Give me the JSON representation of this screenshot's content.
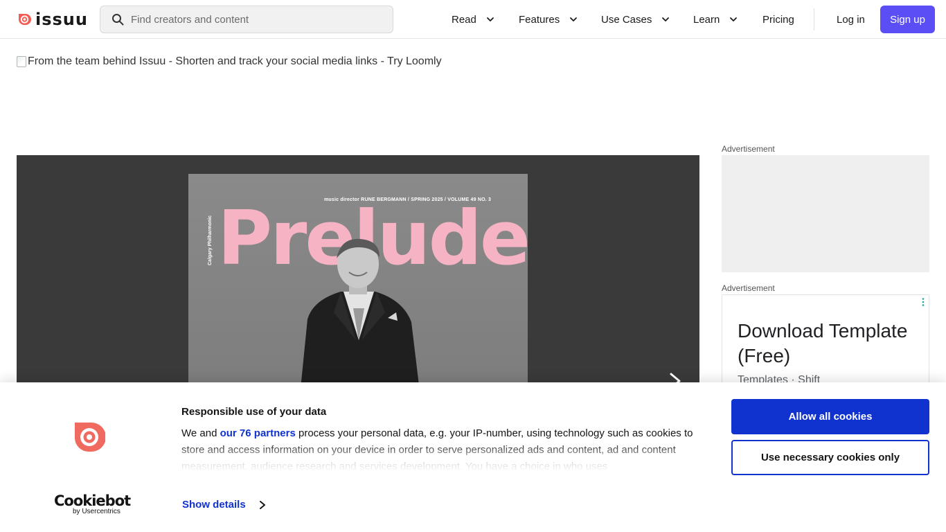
{
  "header": {
    "logo_text": "issuu",
    "search": {
      "placeholder": "Find creators and content",
      "value": ""
    },
    "nav": [
      {
        "label": "Read",
        "has_dropdown": true
      },
      {
        "label": "Features",
        "has_dropdown": true
      },
      {
        "label": "Use Cases",
        "has_dropdown": true
      },
      {
        "label": "Learn",
        "has_dropdown": true
      },
      {
        "label": "Pricing",
        "has_dropdown": false
      }
    ],
    "login_label": "Log in",
    "signup_label": "Sign up"
  },
  "banner": {
    "alt_text": "From the team behind Issuu - Shorten and track your social media links - Try Loomly"
  },
  "viewer": {
    "cover": {
      "meta": "music director RUNE BERGMANN   /  SPRING 2025   /  VOLUME 49 NO. 3",
      "side_text": "Calgary Philharmonic",
      "title": "Prelude"
    }
  },
  "sidebar": {
    "ad1_label": "Advertisement",
    "ad2_label": "Advertisement",
    "ad2": {
      "headline": "Download Template (Free)",
      "sub": "Templates · Shift"
    }
  },
  "cookie_banner": {
    "title": "Responsible use of your data",
    "body_before_link": "We and ",
    "link_text": "our 76 partners",
    "body_after_link": " process your personal data, e.g. your IP-number, using technology such as cookies to store and access information on your device in order to serve personalized ads and content, ad and content measurement, audience research and services development. You have a choice in who uses",
    "show_details_label": "Show details",
    "allow_all_label": "Allow all cookies",
    "necessary_only_label": "Use necessary cookies only",
    "provider_name": "Cookiebot",
    "provider_by": "by Usercentrics"
  },
  "colors": {
    "brand_red": "#f25c54",
    "signup_purple": "#5b4ef5",
    "cookie_blue": "#1032cf",
    "cover_title_pink": "#f5b3c4",
    "viewer_bg": "#3a3a3a"
  },
  "icons": {
    "search": "search-icon",
    "dropdown": "chevron-down-icon",
    "next_page": "chevron-right-icon",
    "ad_options": "more-vertical-icon",
    "show_details": "chevron-right-icon"
  }
}
